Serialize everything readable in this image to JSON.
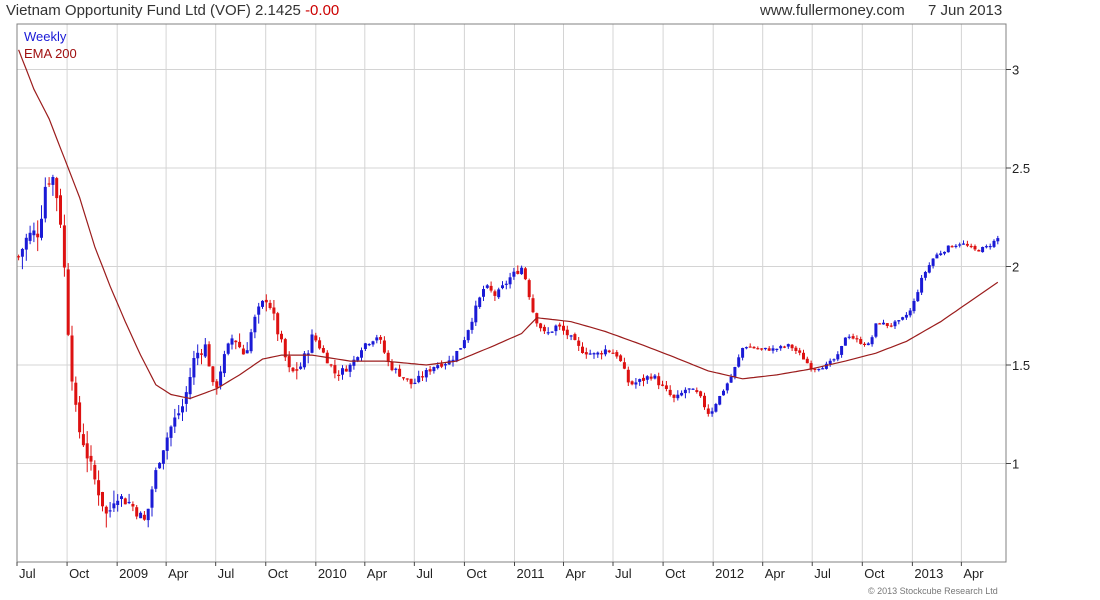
{
  "header": {
    "title": "Vietnam Opportunity Fund Ltd (VOF) 2.1425",
    "change": "-0.00",
    "site": "www.fullermoney.com",
    "date": "7 Jun 2013"
  },
  "legend": {
    "weekly": "Weekly",
    "ema": "EMA 200"
  },
  "copyright": "© 2013 Stockcube Research Ltd",
  "colors": {
    "up": "#1a1ad6",
    "down": "#dd1111",
    "ema": "#9b1c1c",
    "grid": "#d4d4d4",
    "frame": "#808080"
  },
  "chart_data": {
    "type": "candlestick",
    "title": "Vietnam Opportunity Fund Ltd (VOF) 2.1425 -0.00",
    "frequency": "Weekly",
    "x_ticks": [
      "Jul",
      "Oct",
      "2009",
      "Apr",
      "Jul",
      "Oct",
      "2010",
      "Apr",
      "Jul",
      "Oct",
      "2011",
      "Apr",
      "Jul",
      "Oct",
      "2012",
      "Apr",
      "Jul",
      "Oct",
      "2013",
      "Apr"
    ],
    "y_ticks": [
      "1",
      "1.5",
      "2",
      "2.5",
      "3"
    ],
    "ylim": [
      0.55,
      3.25
    ],
    "grid": true,
    "legend_position": "top-left",
    "series": [
      {
        "name": "Weekly",
        "anchors": [
          [
            "2008-07-04",
            2.05
          ],
          [
            "2008-07-20",
            2.15
          ],
          [
            "2008-08-10",
            2.18
          ],
          [
            "2008-08-24",
            2.45
          ],
          [
            "2008-09-07",
            2.45
          ],
          [
            "2008-09-21",
            2.2
          ],
          [
            "2008-10-05",
            1.6
          ],
          [
            "2008-10-19",
            1.2
          ],
          [
            "2008-11-02",
            1.1
          ],
          [
            "2008-11-16",
            0.95
          ],
          [
            "2008-11-30",
            0.85
          ],
          [
            "2008-12-14",
            0.72
          ],
          [
            "2008-12-28",
            0.85
          ],
          [
            "2009-01-11",
            0.82
          ],
          [
            "2009-01-25",
            0.8
          ],
          [
            "2009-02-08",
            0.75
          ],
          [
            "2009-02-22",
            0.7
          ],
          [
            "2009-03-08",
            0.9
          ],
          [
            "2009-03-22",
            1.05
          ],
          [
            "2009-04-12",
            1.2
          ],
          [
            "2009-05-03",
            1.3
          ],
          [
            "2009-05-24",
            1.55
          ],
          [
            "2009-06-14",
            1.6
          ],
          [
            "2009-06-28",
            1.35
          ],
          [
            "2009-07-12",
            1.5
          ],
          [
            "2009-08-02",
            1.65
          ],
          [
            "2009-08-23",
            1.55
          ],
          [
            "2009-09-13",
            1.75
          ],
          [
            "2009-10-04",
            1.85
          ],
          [
            "2009-10-25",
            1.65
          ],
          [
            "2009-11-15",
            1.45
          ],
          [
            "2009-12-06",
            1.5
          ],
          [
            "2009-12-27",
            1.65
          ],
          [
            "2010-01-17",
            1.55
          ],
          [
            "2010-02-07",
            1.45
          ],
          [
            "2010-03-07",
            1.5
          ],
          [
            "2010-03-28",
            1.6
          ],
          [
            "2010-04-25",
            1.65
          ],
          [
            "2010-05-16",
            1.5
          ],
          [
            "2010-06-06",
            1.45
          ],
          [
            "2010-06-27",
            1.4
          ],
          [
            "2010-07-18",
            1.45
          ],
          [
            "2010-08-08",
            1.5
          ],
          [
            "2010-09-05",
            1.52
          ],
          [
            "2010-09-26",
            1.6
          ],
          [
            "2010-10-17",
            1.75
          ],
          [
            "2010-11-07",
            1.9
          ],
          [
            "2010-11-28",
            1.85
          ],
          [
            "2010-12-26",
            1.95
          ],
          [
            "2011-01-16",
            2.0
          ],
          [
            "2011-02-06",
            1.75
          ],
          [
            "2011-02-27",
            1.65
          ],
          [
            "2011-03-20",
            1.7
          ],
          [
            "2011-04-10",
            1.65
          ],
          [
            "2011-05-01",
            1.58
          ],
          [
            "2011-05-29",
            1.55
          ],
          [
            "2011-06-19",
            1.58
          ],
          [
            "2011-07-10",
            1.55
          ],
          [
            "2011-07-31",
            1.4
          ],
          [
            "2011-08-21",
            1.42
          ],
          [
            "2011-09-11",
            1.45
          ],
          [
            "2011-10-02",
            1.38
          ],
          [
            "2011-10-23",
            1.32
          ],
          [
            "2011-11-13",
            1.38
          ],
          [
            "2011-12-04",
            1.35
          ],
          [
            "2011-12-25",
            1.25
          ],
          [
            "2012-01-15",
            1.35
          ],
          [
            "2012-02-05",
            1.45
          ],
          [
            "2012-02-26",
            1.6
          ],
          [
            "2012-03-25",
            1.58
          ],
          [
            "2012-04-22",
            1.58
          ],
          [
            "2012-05-20",
            1.6
          ],
          [
            "2012-06-10",
            1.55
          ],
          [
            "2012-07-01",
            1.48
          ],
          [
            "2012-07-29",
            1.5
          ],
          [
            "2012-08-19",
            1.55
          ],
          [
            "2012-09-02",
            1.66
          ],
          [
            "2012-09-23",
            1.62
          ],
          [
            "2012-10-14",
            1.6
          ],
          [
            "2012-10-28",
            1.72
          ],
          [
            "2012-11-18",
            1.7
          ],
          [
            "2012-12-09",
            1.72
          ],
          [
            "2012-12-30",
            1.78
          ],
          [
            "2013-01-20",
            1.95
          ],
          [
            "2013-02-10",
            2.05
          ],
          [
            "2013-03-10",
            2.1
          ],
          [
            "2013-03-31",
            2.12
          ],
          [
            "2013-04-28",
            2.08
          ],
          [
            "2013-05-19",
            2.1
          ],
          [
            "2013-06-07",
            2.1425
          ]
        ]
      },
      {
        "name": "EMA 200",
        "anchors": [
          [
            "2008-07-04",
            3.1
          ],
          [
            "2008-08-01",
            2.9
          ],
          [
            "2008-08-29",
            2.75
          ],
          [
            "2008-09-26",
            2.55
          ],
          [
            "2008-10-24",
            2.35
          ],
          [
            "2008-11-21",
            2.1
          ],
          [
            "2008-12-19",
            1.9
          ],
          [
            "2009-01-16",
            1.72
          ],
          [
            "2009-02-13",
            1.55
          ],
          [
            "2009-03-13",
            1.4
          ],
          [
            "2009-04-10",
            1.35
          ],
          [
            "2009-05-15",
            1.33
          ],
          [
            "2009-07-03",
            1.38
          ],
          [
            "2009-08-14",
            1.45
          ],
          [
            "2009-09-25",
            1.53
          ],
          [
            "2009-10-30",
            1.55
          ],
          [
            "2009-12-25",
            1.55
          ],
          [
            "2010-03-05",
            1.52
          ],
          [
            "2010-05-07",
            1.52
          ],
          [
            "2010-07-23",
            1.5
          ],
          [
            "2010-09-17",
            1.52
          ],
          [
            "2010-11-26",
            1.6
          ],
          [
            "2011-01-14",
            1.66
          ],
          [
            "2011-02-11",
            1.74
          ],
          [
            "2011-04-15",
            1.72
          ],
          [
            "2011-06-17",
            1.67
          ],
          [
            "2011-08-26",
            1.6
          ],
          [
            "2011-10-21",
            1.54
          ],
          [
            "2011-12-23",
            1.47
          ],
          [
            "2012-02-24",
            1.43
          ],
          [
            "2012-04-27",
            1.45
          ],
          [
            "2012-06-29",
            1.48
          ],
          [
            "2012-08-31",
            1.52
          ],
          [
            "2012-10-26",
            1.56
          ],
          [
            "2012-12-21",
            1.62
          ],
          [
            "2013-02-22",
            1.72
          ],
          [
            "2013-04-26",
            1.84
          ],
          [
            "2013-06-07",
            1.92
          ]
        ]
      }
    ]
  }
}
